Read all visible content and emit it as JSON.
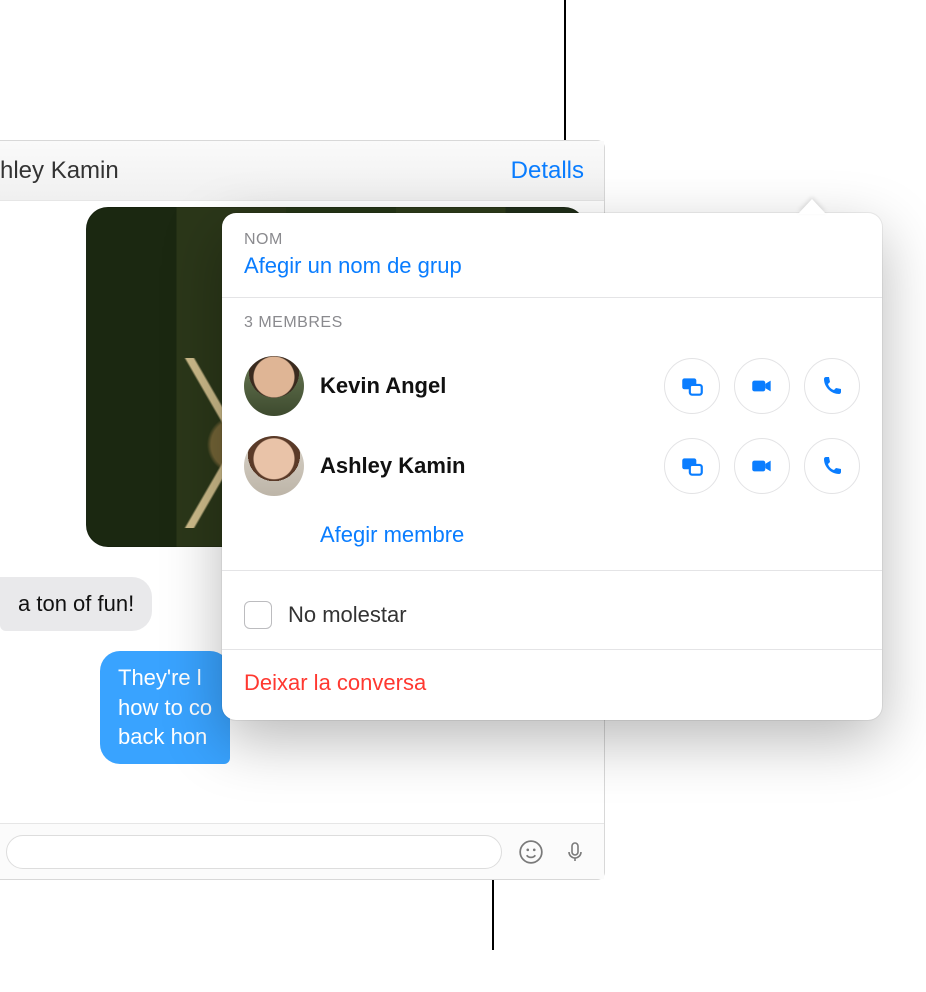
{
  "header": {
    "title": "hley Kamin",
    "details_button": "Detalls"
  },
  "messages": {
    "incoming1": "a ton of fun!",
    "outgoing1": "They're l\nhow to co\nback hon"
  },
  "popover": {
    "sections": {
      "name_label": "Nom",
      "group_name_action": "Afegir un nom de grup",
      "members_label": "3 membres",
      "add_member": "Afegir membre",
      "dnd_label": "No molestar",
      "leave": "Deixar la conversa"
    },
    "members": [
      {
        "name": "Kevin Angel"
      },
      {
        "name": "Ashley Kamin"
      }
    ]
  },
  "colors": {
    "accent": "#0a7dff",
    "danger": "#ff3830"
  }
}
